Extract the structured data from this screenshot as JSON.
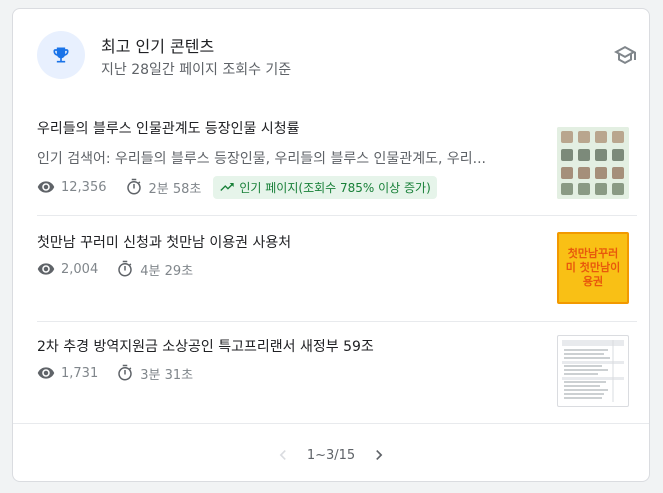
{
  "header": {
    "title": "최고 인기 콘텐츠",
    "subtitle": "지난 28일간 페이지 조회수 기준"
  },
  "items": [
    {
      "title": "우리들의 블루스 인물관계도 등장인물 시청률",
      "description": "인기 검색어: 우리들의 블루스 등장인물, 우리들의 블루스 인물관계도, 우리...",
      "views": "12,356",
      "duration": "2분 58초",
      "trend_label": "인기 페이지(조회수 785% 이상 증가)"
    },
    {
      "title": "첫만남 꾸러미 신청과 첫만남 이용권 사용처",
      "views": "2,004",
      "duration": "4분 29초",
      "thumb_text": "첫만남꾸러미 첫만남이용권"
    },
    {
      "title": "2차 추경 방역지원금 소상공인 특고프리랜서 새정부 59조",
      "views": "1,731",
      "duration": "3분 31초"
    }
  ],
  "pagination": {
    "label": "1~3/15"
  },
  "colors": {
    "accent": "#1a73e8",
    "trend_bg": "#e6f4ea",
    "trend_text": "#188038",
    "thumb2_bg": "#f9c015",
    "thumb2_border": "#f29900"
  }
}
